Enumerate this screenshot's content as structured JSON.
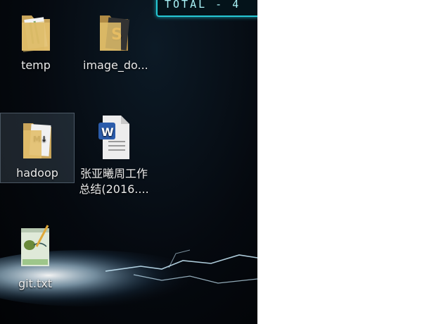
{
  "overlay": {
    "text": "TOTAL - 4"
  },
  "desktop_icons": [
    {
      "label": "temp",
      "type": "folder"
    },
    {
      "label": "image_do...",
      "type": "folder"
    },
    {
      "label": "hadoop",
      "type": "folder",
      "selected": true
    },
    {
      "label_line1": "张亚曦周工作",
      "label_line2": "总结(2016....",
      "type": "word-document"
    },
    {
      "label": "git.txt",
      "type": "text-file"
    }
  ],
  "colors": {
    "background": "#05090f",
    "accent": "#26c7d4",
    "label": "#e9e9e9"
  }
}
